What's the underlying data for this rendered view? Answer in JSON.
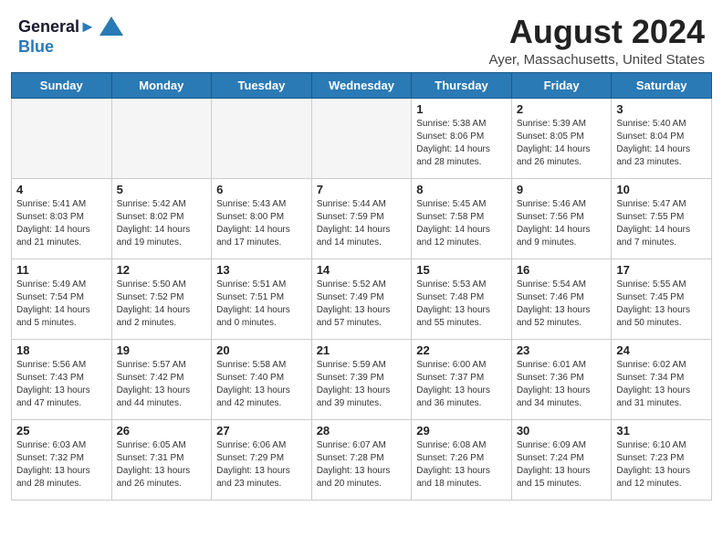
{
  "header": {
    "logo_line1": "General",
    "logo_line2": "Blue",
    "month": "August 2024",
    "location": "Ayer, Massachusetts, United States"
  },
  "days_of_week": [
    "Sunday",
    "Monday",
    "Tuesday",
    "Wednesday",
    "Thursday",
    "Friday",
    "Saturday"
  ],
  "weeks": [
    [
      {
        "day": "",
        "text": ""
      },
      {
        "day": "",
        "text": ""
      },
      {
        "day": "",
        "text": ""
      },
      {
        "day": "",
        "text": ""
      },
      {
        "day": "1",
        "text": "Sunrise: 5:38 AM\nSunset: 8:06 PM\nDaylight: 14 hours\nand 28 minutes."
      },
      {
        "day": "2",
        "text": "Sunrise: 5:39 AM\nSunset: 8:05 PM\nDaylight: 14 hours\nand 26 minutes."
      },
      {
        "day": "3",
        "text": "Sunrise: 5:40 AM\nSunset: 8:04 PM\nDaylight: 14 hours\nand 23 minutes."
      }
    ],
    [
      {
        "day": "4",
        "text": "Sunrise: 5:41 AM\nSunset: 8:03 PM\nDaylight: 14 hours\nand 21 minutes."
      },
      {
        "day": "5",
        "text": "Sunrise: 5:42 AM\nSunset: 8:02 PM\nDaylight: 14 hours\nand 19 minutes."
      },
      {
        "day": "6",
        "text": "Sunrise: 5:43 AM\nSunset: 8:00 PM\nDaylight: 14 hours\nand 17 minutes."
      },
      {
        "day": "7",
        "text": "Sunrise: 5:44 AM\nSunset: 7:59 PM\nDaylight: 14 hours\nand 14 minutes."
      },
      {
        "day": "8",
        "text": "Sunrise: 5:45 AM\nSunset: 7:58 PM\nDaylight: 14 hours\nand 12 minutes."
      },
      {
        "day": "9",
        "text": "Sunrise: 5:46 AM\nSunset: 7:56 PM\nDaylight: 14 hours\nand 9 minutes."
      },
      {
        "day": "10",
        "text": "Sunrise: 5:47 AM\nSunset: 7:55 PM\nDaylight: 14 hours\nand 7 minutes."
      }
    ],
    [
      {
        "day": "11",
        "text": "Sunrise: 5:49 AM\nSunset: 7:54 PM\nDaylight: 14 hours\nand 5 minutes."
      },
      {
        "day": "12",
        "text": "Sunrise: 5:50 AM\nSunset: 7:52 PM\nDaylight: 14 hours\nand 2 minutes."
      },
      {
        "day": "13",
        "text": "Sunrise: 5:51 AM\nSunset: 7:51 PM\nDaylight: 14 hours\nand 0 minutes."
      },
      {
        "day": "14",
        "text": "Sunrise: 5:52 AM\nSunset: 7:49 PM\nDaylight: 13 hours\nand 57 minutes."
      },
      {
        "day": "15",
        "text": "Sunrise: 5:53 AM\nSunset: 7:48 PM\nDaylight: 13 hours\nand 55 minutes."
      },
      {
        "day": "16",
        "text": "Sunrise: 5:54 AM\nSunset: 7:46 PM\nDaylight: 13 hours\nand 52 minutes."
      },
      {
        "day": "17",
        "text": "Sunrise: 5:55 AM\nSunset: 7:45 PM\nDaylight: 13 hours\nand 50 minutes."
      }
    ],
    [
      {
        "day": "18",
        "text": "Sunrise: 5:56 AM\nSunset: 7:43 PM\nDaylight: 13 hours\nand 47 minutes."
      },
      {
        "day": "19",
        "text": "Sunrise: 5:57 AM\nSunset: 7:42 PM\nDaylight: 13 hours\nand 44 minutes."
      },
      {
        "day": "20",
        "text": "Sunrise: 5:58 AM\nSunset: 7:40 PM\nDaylight: 13 hours\nand 42 minutes."
      },
      {
        "day": "21",
        "text": "Sunrise: 5:59 AM\nSunset: 7:39 PM\nDaylight: 13 hours\nand 39 minutes."
      },
      {
        "day": "22",
        "text": "Sunrise: 6:00 AM\nSunset: 7:37 PM\nDaylight: 13 hours\nand 36 minutes."
      },
      {
        "day": "23",
        "text": "Sunrise: 6:01 AM\nSunset: 7:36 PM\nDaylight: 13 hours\nand 34 minutes."
      },
      {
        "day": "24",
        "text": "Sunrise: 6:02 AM\nSunset: 7:34 PM\nDaylight: 13 hours\nand 31 minutes."
      }
    ],
    [
      {
        "day": "25",
        "text": "Sunrise: 6:03 AM\nSunset: 7:32 PM\nDaylight: 13 hours\nand 28 minutes."
      },
      {
        "day": "26",
        "text": "Sunrise: 6:05 AM\nSunset: 7:31 PM\nDaylight: 13 hours\nand 26 minutes."
      },
      {
        "day": "27",
        "text": "Sunrise: 6:06 AM\nSunset: 7:29 PM\nDaylight: 13 hours\nand 23 minutes."
      },
      {
        "day": "28",
        "text": "Sunrise: 6:07 AM\nSunset: 7:28 PM\nDaylight: 13 hours\nand 20 minutes."
      },
      {
        "day": "29",
        "text": "Sunrise: 6:08 AM\nSunset: 7:26 PM\nDaylight: 13 hours\nand 18 minutes."
      },
      {
        "day": "30",
        "text": "Sunrise: 6:09 AM\nSunset: 7:24 PM\nDaylight: 13 hours\nand 15 minutes."
      },
      {
        "day": "31",
        "text": "Sunrise: 6:10 AM\nSunset: 7:23 PM\nDaylight: 13 hours\nand 12 minutes."
      }
    ]
  ]
}
